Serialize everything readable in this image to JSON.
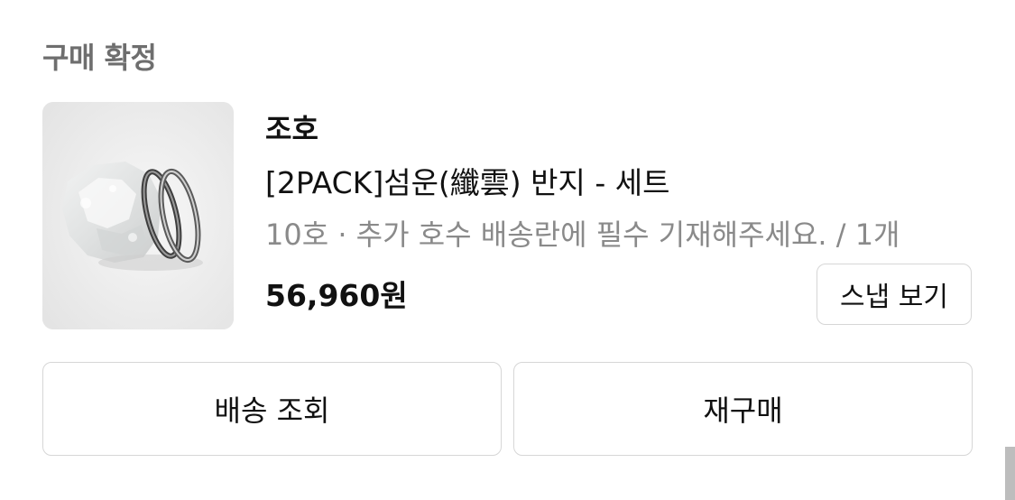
{
  "order": {
    "status": "구매 확정",
    "item": {
      "brand": "조호",
      "name": "[2PACK]섬운(纖雲) 반지 - 세트",
      "option": "10호 · 추가 호수 배송란에 필수 기재해주세요. / 1개",
      "price": "56,960원",
      "snap_label": "스냅 보기"
    },
    "actions": {
      "tracking_label": "배송 조회",
      "rebuy_label": "재구매"
    }
  }
}
